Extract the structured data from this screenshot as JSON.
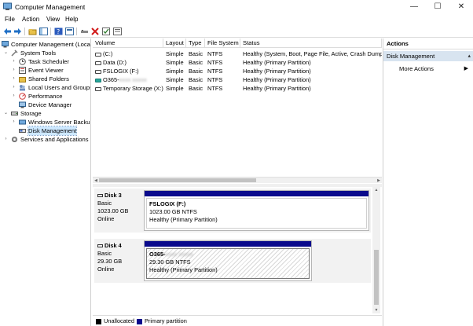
{
  "window": {
    "title": "Computer Management"
  },
  "menu": [
    "File",
    "Action",
    "View",
    "Help"
  ],
  "toolbar": {
    "icons": [
      "back-icon",
      "forward-icon",
      "up-folder-icon",
      "console-tree-icon",
      "help-icon",
      "properties-icon",
      "connect-icon",
      "delete-icon",
      "check-icon",
      "snapin-icon"
    ]
  },
  "tree": {
    "root": "Computer Management (Local",
    "system_tools": "System Tools",
    "task_scheduler": "Task Scheduler",
    "event_viewer": "Event Viewer",
    "shared_folders": "Shared Folders",
    "local_users": "Local Users and Groups",
    "performance": "Performance",
    "device_manager": "Device Manager",
    "storage": "Storage",
    "windows_backup": "Windows Server Backup",
    "disk_management": "Disk Management",
    "services": "Services and Applications"
  },
  "volumes": {
    "columns": [
      "Volume",
      "Layout",
      "Type",
      "File System",
      "Status"
    ],
    "rows": [
      {
        "volume": "(C:)",
        "layout": "Simple",
        "type": "Basic",
        "fs": "NTFS",
        "status": "Healthy (System, Boot, Page File, Active, Crash Dump,",
        "icon": "plain"
      },
      {
        "volume": "Data (D:)",
        "layout": "Simple",
        "type": "Basic",
        "fs": "NTFS",
        "status": "Healthy (Primary Partition)",
        "icon": "plain"
      },
      {
        "volume": "FSLOGIX (F:)",
        "layout": "Simple",
        "type": "Basic",
        "fs": "NTFS",
        "status": "Healthy (Primary Partition)",
        "icon": "plain"
      },
      {
        "volume": "O365-",
        "layout": "Simple",
        "type": "Basic",
        "fs": "NTFS",
        "status": "Healthy (Primary Partition)",
        "icon": "teal"
      },
      {
        "volume": "Temporary Storage (X:)",
        "layout": "Simple",
        "type": "Basic",
        "fs": "NTFS",
        "status": "Healthy (Primary Partition)",
        "icon": "plain"
      }
    ]
  },
  "disks": [
    {
      "name": "Disk 3",
      "type": "Basic",
      "size": "1023.00 GB",
      "state": "Online",
      "partition": {
        "name": "FSLOGIX  (F:)",
        "detail": "1023.00 GB NTFS",
        "status": "Healthy (Primary Partition)"
      }
    },
    {
      "name": "Disk 4",
      "type": "Basic",
      "size": "29.30 GB",
      "state": "Online",
      "partition": {
        "name": "O365-",
        "detail": "29.30 GB NTFS",
        "status": "Healthy (Primary Partition)"
      }
    }
  ],
  "legend": [
    {
      "label": "Unallocated",
      "color": "#000000"
    },
    {
      "label": "Primary partition",
      "color": "#0a0a8c"
    }
  ],
  "actions": {
    "header": "Actions",
    "section": "Disk Management",
    "more": "More Actions"
  }
}
